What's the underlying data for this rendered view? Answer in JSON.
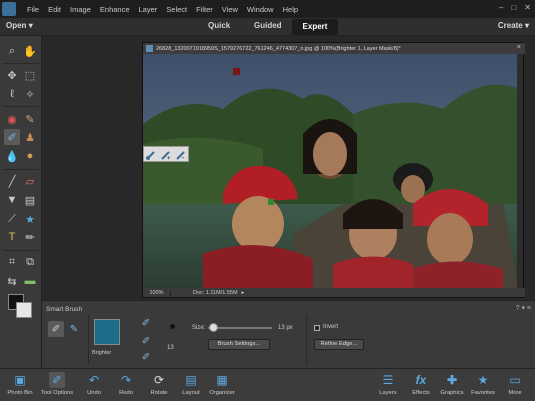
{
  "menubar": {
    "items": [
      "File",
      "Edit",
      "Image",
      "Enhance",
      "Layer",
      "Select",
      "Filter",
      "View",
      "Window",
      "Help"
    ],
    "window_controls": [
      "–",
      "□",
      "✕"
    ]
  },
  "modebar": {
    "open_label": "Open",
    "modes": [
      "Quick",
      "Guided",
      "Expert"
    ],
    "active_mode": "Expert",
    "create_label": "Create"
  },
  "document": {
    "title": "26828_1320071918959S_1579276722_761246_4774307_n.jpg @ 100%(Brighter 1, Layer Mask/8)*",
    "close": "×",
    "zoom": "100%",
    "doc_info": "Doc: 1.11M/1.55M"
  },
  "tool_options": {
    "title": "Smart Brush",
    "preset_label": "Brighter",
    "size_label": "Size:",
    "size_value": "13 px",
    "size_fraction": 0.08,
    "brush_number": "13",
    "brush_settings_label": "Brush Settings...",
    "invert_label": "Invert",
    "refine_edge_label": "Refine Edge...",
    "help": "?"
  },
  "bottombar": {
    "left": [
      {
        "label": "Photo Bin",
        "icon": "photo-bin-icon"
      },
      {
        "label": "Tool Options",
        "icon": "tool-options-icon",
        "active": true
      },
      {
        "label": "Undo",
        "icon": "undo-icon"
      },
      {
        "label": "Redo",
        "icon": "redo-icon"
      },
      {
        "label": "Rotate",
        "icon": "rotate-icon"
      },
      {
        "label": "Layout",
        "icon": "layout-icon"
      },
      {
        "label": "Organizer",
        "icon": "organizer-icon"
      }
    ],
    "right": [
      {
        "label": "Layers",
        "icon": "layers-icon"
      },
      {
        "label": "Effects",
        "icon": "effects-icon"
      },
      {
        "label": "Graphics",
        "icon": "graphics-icon"
      },
      {
        "label": "Favorites",
        "icon": "favorites-icon"
      },
      {
        "label": "More",
        "icon": "more-icon"
      }
    ]
  },
  "colors": {
    "accent": "#3a6f99",
    "foreground_swatch": "#111111",
    "background_swatch": "#e6e6e6"
  }
}
